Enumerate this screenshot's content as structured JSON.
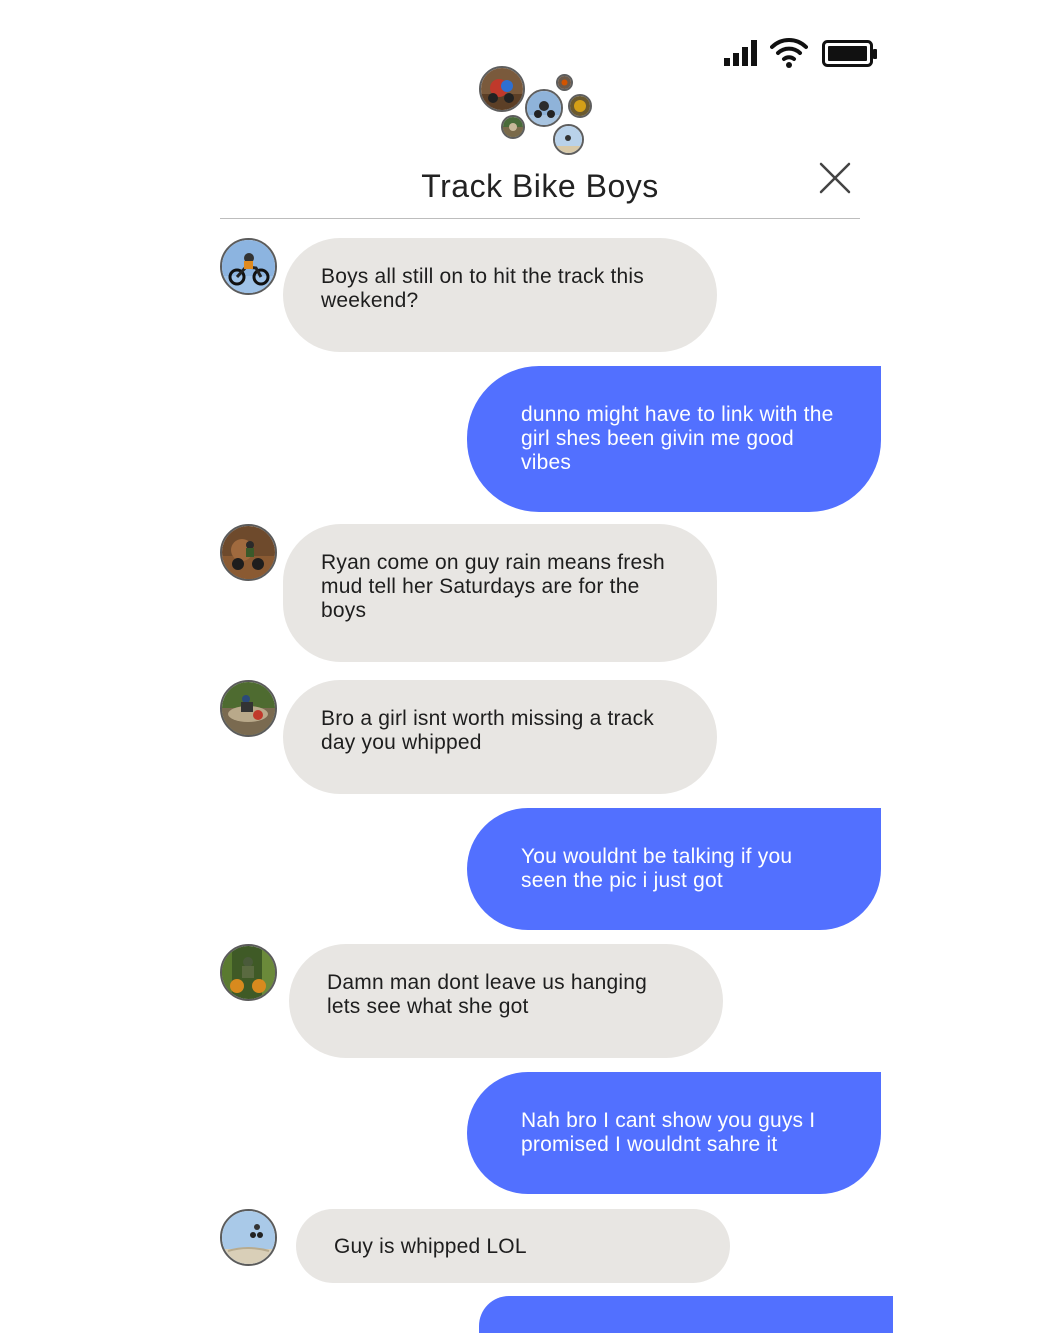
{
  "chat": {
    "title": "Track Bike Boys"
  },
  "messages": [
    {
      "direction": "incoming",
      "avatar": "rider-blue-sky-avatar",
      "text": "Boys all still on to hit the track this weekend?"
    },
    {
      "direction": "outgoing",
      "text": "dunno might have to link with the girl shes been givin me good vibes"
    },
    {
      "direction": "incoming",
      "avatar": "rider-mud-avatar",
      "text": "Ryan come on guy rain means fresh mud tell her Saturdays are for the boys"
    },
    {
      "direction": "incoming",
      "avatar": "rider-splash-avatar",
      "text": "Bro a girl isnt worth missing a track day you whipped"
    },
    {
      "direction": "outgoing",
      "text": "You wouldnt be talking if you seen the pic i just got"
    },
    {
      "direction": "incoming",
      "avatar": "rider-forest-avatar",
      "text": "Damn man dont leave us hanging lets see what she got"
    },
    {
      "direction": "outgoing",
      "text": "Nah bro I cant show you guys I promised I wouldnt sahre it"
    },
    {
      "direction": "incoming",
      "avatar": "rider-jump-avatar",
      "text": "Guy is whipped LOL"
    },
    {
      "direction": "outgoing",
      "text": ""
    }
  ],
  "colors": {
    "incoming_bubble": "#e8e6e3",
    "outgoing_bubble": "#5270ff",
    "outgoing_text": "#ffffff"
  },
  "icons": {
    "signal": "signal-strength-icon",
    "wifi": "wifi-icon",
    "battery": "battery-icon",
    "close": "close-icon"
  }
}
